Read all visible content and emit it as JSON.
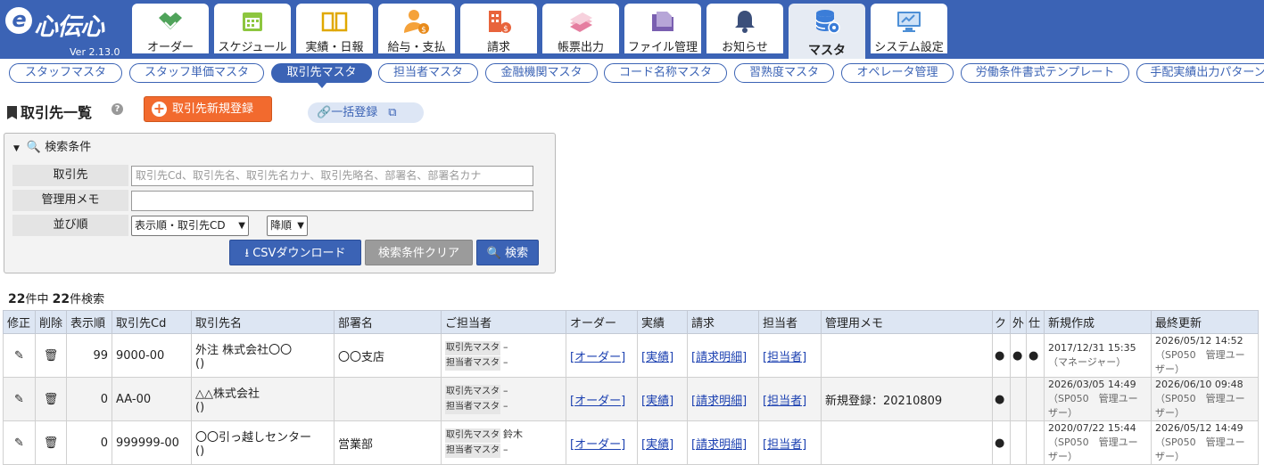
{
  "app": {
    "logo": "心伝心",
    "logo_e": "e",
    "version": "Ver 2.13.0"
  },
  "nav": [
    {
      "label": "オーダー",
      "icon": "handshake-icon"
    },
    {
      "label": "スケジュール",
      "icon": "calendar-icon"
    },
    {
      "label": "実績・日報",
      "icon": "book-icon"
    },
    {
      "label": "給与・支払",
      "icon": "person-dollar-icon"
    },
    {
      "label": "請求",
      "icon": "building-dollar-icon"
    },
    {
      "label": "帳票出力",
      "icon": "papers-icon"
    },
    {
      "label": "ファイル管理",
      "icon": "folder-icon"
    },
    {
      "label": "お知らせ",
      "icon": "bell-icon"
    },
    {
      "label": "マスタ",
      "icon": "database-gear-icon",
      "active": true
    },
    {
      "label": "システム設定",
      "icon": "monitor-settings-icon"
    }
  ],
  "subnav": [
    "スタッフマスタ",
    "スタッフ単価マスタ",
    "取引先マスタ",
    "担当者マスタ",
    "金融機関マスタ",
    "コード名称マスタ",
    "習熟度マスタ",
    "オペレータ管理",
    "労働条件書式テンプレート",
    "手配実績出力パターン"
  ],
  "page": {
    "title": "取引先一覧",
    "help": "?",
    "new_button": "取引先新規登録",
    "bulk_button": "一括登録"
  },
  "search": {
    "header": "検索条件",
    "client_label": "取引先",
    "client_placeholder": "取引先Cd、取引先名、取引先名カナ、取引先略名、部署名、部署名カナ",
    "memo_label": "管理用メモ",
    "memo_value": "",
    "sort_label": "並び順",
    "sort_value": "表示順・取引先CD",
    "order_value": "降順",
    "csv_button": "CSVダウンロード",
    "clear_button": "検索条件クリア",
    "search_button": "検索"
  },
  "count": {
    "total": "22",
    "total_suffix": "件中",
    "hits": "22",
    "hits_suffix": "件検索"
  },
  "table": {
    "headers": [
      "修正",
      "削除",
      "表示順",
      "取引先Cd",
      "取引先名",
      "部署名",
      "ご担当者",
      "オーダー",
      "実績",
      "請求",
      "担当者",
      "管理用メモ",
      "ク",
      "外",
      "仕",
      "新規作成",
      "最終更新"
    ],
    "rows": [
      {
        "order": "99",
        "code": "9000-00",
        "name": "外注 株式会社〇〇",
        "name_sub": "()",
        "dept": "〇〇支店",
        "contact_tag1": "取引先マスタ",
        "contact1": "–",
        "contact_tag2": "担当者マスタ",
        "contact2": "–",
        "link_order": "[オーダー]",
        "link_result": "[実績]",
        "link_bill": "[請求明細]",
        "link_staff": "[担当者]",
        "memo": "",
        "k": "●",
        "g": "●",
        "s": "●",
        "created": "2017/12/31 15:35",
        "created_by": "（マネージャー）",
        "updated": "2026/05/12 14:52",
        "updated_by": "（SP050　管理ユーザー）"
      },
      {
        "order": "0",
        "code": "AA-00",
        "name": "△△株式会社",
        "name_sub": "()",
        "dept": "",
        "contact_tag1": "取引先マスタ",
        "contact1": "–",
        "contact_tag2": "担当者マスタ",
        "contact2": "–",
        "link_order": "[オーダー]",
        "link_result": "[実績]",
        "link_bill": "[請求明細]",
        "link_staff": "[担当者]",
        "memo": "新規登録：20210809",
        "k": "●",
        "g": "",
        "s": "",
        "created": "2026/03/05 14:49",
        "created_by": "（SP050　管理ユーザー）",
        "updated": "2026/06/10 09:48",
        "updated_by": "（SP050　管理ユーザー）"
      },
      {
        "order": "0",
        "code": "999999-00",
        "name": "〇〇引っ越しセンター",
        "name_sub": "()",
        "dept": "営業部",
        "contact_tag1": "取引先マスタ",
        "contact1": "鈴木",
        "contact_tag2": "担当者マスタ",
        "contact2": "–",
        "link_order": "[オーダー]",
        "link_result": "[実績]",
        "link_bill": "[請求明細]",
        "link_staff": "[担当者]",
        "memo": "",
        "k": "●",
        "g": "",
        "s": "",
        "created": "2020/07/22 15:44",
        "created_by": "（SP050　管理ユーザー）",
        "updated": "2026/05/12 14:49",
        "updated_by": "（SP050　管理ユーザー）"
      }
    ]
  }
}
